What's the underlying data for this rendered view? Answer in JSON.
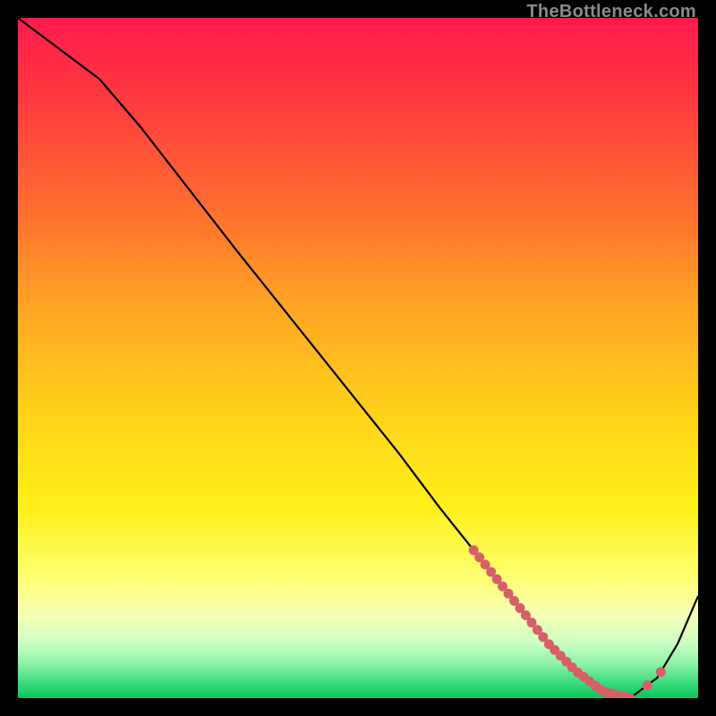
{
  "watermark": "TheBottleneck.com",
  "chart_data": {
    "type": "line",
    "title": "",
    "xlabel": "",
    "ylabel": "",
    "xlim": [
      0,
      100
    ],
    "ylim": [
      0,
      100
    ],
    "grid": false,
    "series": [
      {
        "name": "curve",
        "x": [
          0,
          4,
          8,
          12,
          18,
          25,
          32,
          40,
          48,
          56,
          62,
          66,
          70,
          74,
          78,
          82,
          86,
          90,
          94,
          97,
          100
        ],
        "y": [
          100,
          97,
          94,
          91,
          84,
          75,
          66,
          56,
          46,
          36,
          28,
          23,
          18,
          13,
          8,
          4,
          1,
          0,
          3,
          8,
          15
        ]
      }
    ],
    "markers_band": {
      "x_start": 67,
      "x_end": 90,
      "count": 28
    },
    "markers_extra": [
      {
        "x": 92.5
      },
      {
        "x": 94.5
      }
    ],
    "colors": {
      "curve_stroke": "#000000",
      "marker_fill": "#d6606a",
      "gradient_top": "#ff1a4d",
      "gradient_bottom": "#0cc45a"
    }
  }
}
